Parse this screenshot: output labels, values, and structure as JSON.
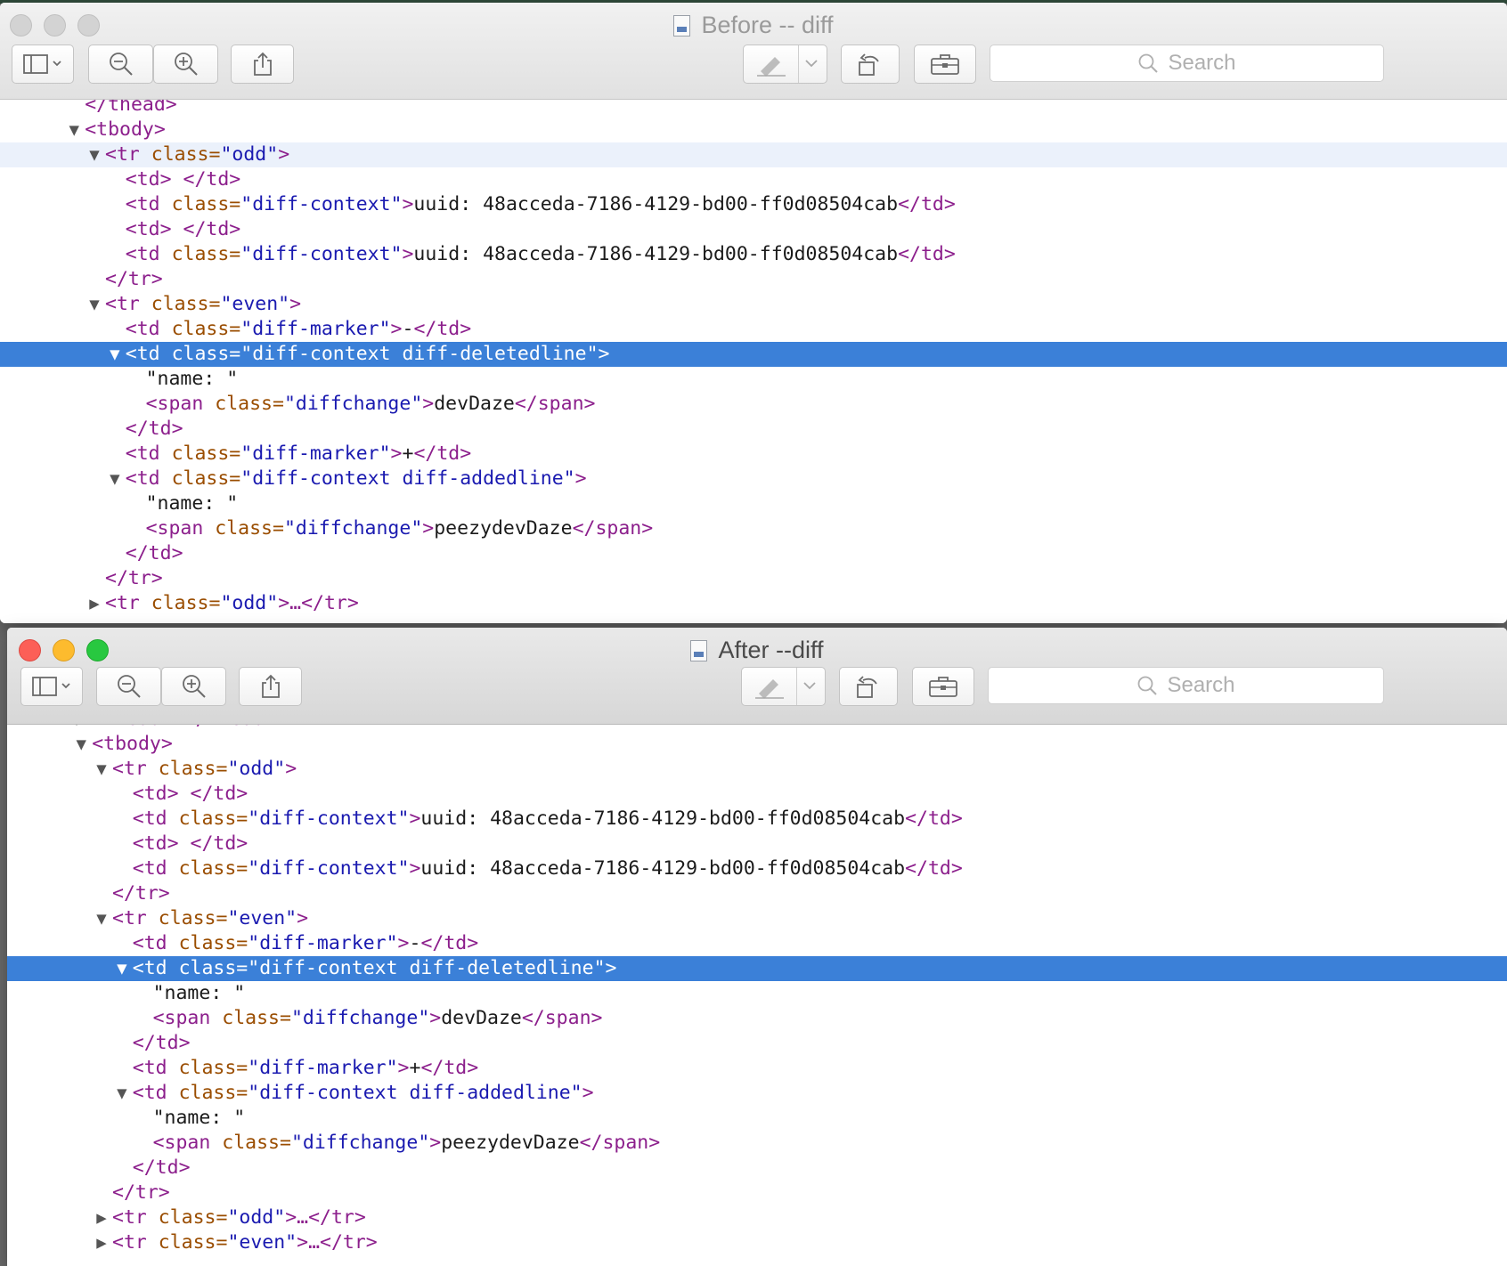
{
  "windows": [
    {
      "title": "Before -- diff",
      "search_placeholder": "Search",
      "icons": [
        "sidebar-icon",
        "zoom-out-icon",
        "zoom-in-icon",
        "share-icon",
        "markup-icon",
        "rotate-icon",
        "toolbox-icon",
        "search-icon"
      ],
      "lines": [
        {
          "indent": 4,
          "disc": "",
          "parts": [
            [
              "t",
              "</thead>"
            ]
          ]
        },
        {
          "indent": 4,
          "disc": "open",
          "parts": [
            [
              "t",
              "<tbody>"
            ]
          ]
        },
        {
          "indent": 5,
          "disc": "open",
          "hover": true,
          "parts": [
            [
              "t",
              "<tr "
            ],
            [
              "a",
              "class="
            ],
            [
              "v",
              "\"odd\""
            ],
            [
              "t",
              ">"
            ]
          ]
        },
        {
          "indent": 6,
          "disc": "",
          "parts": [
            [
              "t",
              "<td> </td>"
            ]
          ]
        },
        {
          "indent": 6,
          "disc": "",
          "parts": [
            [
              "t",
              "<td "
            ],
            [
              "a",
              "class="
            ],
            [
              "v",
              "\"diff-context\""
            ],
            [
              "t",
              ">"
            ],
            [
              "x",
              "uuid: 48acceda-7186-4129-bd00-ff0d08504cab"
            ],
            [
              "t",
              "</td>"
            ]
          ]
        },
        {
          "indent": 6,
          "disc": "",
          "parts": [
            [
              "t",
              "<td> </td>"
            ]
          ]
        },
        {
          "indent": 6,
          "disc": "",
          "parts": [
            [
              "t",
              "<td "
            ],
            [
              "a",
              "class="
            ],
            [
              "v",
              "\"diff-context\""
            ],
            [
              "t",
              ">"
            ],
            [
              "x",
              "uuid: 48acceda-7186-4129-bd00-ff0d08504cab"
            ],
            [
              "t",
              "</td>"
            ]
          ]
        },
        {
          "indent": 5,
          "disc": "",
          "parts": [
            [
              "t",
              "</tr>"
            ]
          ]
        },
        {
          "indent": 5,
          "disc": "open",
          "parts": [
            [
              "t",
              "<tr "
            ],
            [
              "a",
              "class="
            ],
            [
              "v",
              "\"even\""
            ],
            [
              "t",
              ">"
            ]
          ]
        },
        {
          "indent": 6,
          "disc": "",
          "parts": [
            [
              "t",
              "<td "
            ],
            [
              "a",
              "class="
            ],
            [
              "v",
              "\"diff-marker\""
            ],
            [
              "t",
              ">"
            ],
            [
              "x",
              "-"
            ],
            [
              "t",
              "</td>"
            ]
          ]
        },
        {
          "indent": 6,
          "disc": "open",
          "selected": true,
          "parts": [
            [
              "t",
              "<td "
            ],
            [
              "a",
              "class="
            ],
            [
              "v",
              "\"diff-context diff-deletedline\""
            ],
            [
              "t",
              ">"
            ]
          ]
        },
        {
          "indent": 7,
          "disc": "",
          "parts": [
            [
              "x",
              "\"name: \""
            ]
          ]
        },
        {
          "indent": 7,
          "disc": "",
          "parts": [
            [
              "t",
              "<span "
            ],
            [
              "a",
              "class="
            ],
            [
              "v",
              "\"diffchange\""
            ],
            [
              "t",
              ">"
            ],
            [
              "x",
              "devDaze"
            ],
            [
              "t",
              "</span>"
            ]
          ]
        },
        {
          "indent": 6,
          "disc": "",
          "parts": [
            [
              "t",
              "</td>"
            ]
          ]
        },
        {
          "indent": 6,
          "disc": "",
          "parts": [
            [
              "t",
              "<td "
            ],
            [
              "a",
              "class="
            ],
            [
              "v",
              "\"diff-marker\""
            ],
            [
              "t",
              ">"
            ],
            [
              "x",
              "+"
            ],
            [
              "t",
              "</td>"
            ]
          ]
        },
        {
          "indent": 6,
          "disc": "open",
          "parts": [
            [
              "t",
              "<td "
            ],
            [
              "a",
              "class="
            ],
            [
              "v",
              "\"diff-context diff-addedline\""
            ],
            [
              "t",
              ">"
            ]
          ]
        },
        {
          "indent": 7,
          "disc": "",
          "parts": [
            [
              "x",
              "\"name: \""
            ]
          ]
        },
        {
          "indent": 7,
          "disc": "",
          "parts": [
            [
              "t",
              "<span "
            ],
            [
              "a",
              "class="
            ],
            [
              "v",
              "\"diffchange\""
            ],
            [
              "t",
              ">"
            ],
            [
              "x",
              "peezydevDaze"
            ],
            [
              "t",
              "</span>"
            ]
          ]
        },
        {
          "indent": 6,
          "disc": "",
          "parts": [
            [
              "t",
              "</td>"
            ]
          ]
        },
        {
          "indent": 5,
          "disc": "",
          "parts": [
            [
              "t",
              "</tr>"
            ]
          ]
        },
        {
          "indent": 5,
          "disc": "closed",
          "parts": [
            [
              "t",
              "<tr "
            ],
            [
              "a",
              "class="
            ],
            [
              "v",
              "\"odd\""
            ],
            [
              "t",
              ">…</tr>"
            ]
          ]
        }
      ]
    },
    {
      "title": "After --diff",
      "search_placeholder": "Search",
      "icons": [
        "sidebar-icon",
        "zoom-out-icon",
        "zoom-in-icon",
        "share-icon",
        "markup-icon",
        "rotate-icon",
        "toolbox-icon",
        "search-icon"
      ],
      "lines": [
        {
          "indent": 4,
          "disc": "closed",
          "parts": [
            [
              "t",
              "<thead>…</thead>"
            ]
          ]
        },
        {
          "indent": 4,
          "disc": "open",
          "parts": [
            [
              "t",
              "<tbody>"
            ]
          ]
        },
        {
          "indent": 5,
          "disc": "open",
          "parts": [
            [
              "t",
              "<tr "
            ],
            [
              "a",
              "class="
            ],
            [
              "v",
              "\"odd\""
            ],
            [
              "t",
              ">"
            ]
          ]
        },
        {
          "indent": 6,
          "disc": "",
          "parts": [
            [
              "t",
              "<td> </td>"
            ]
          ]
        },
        {
          "indent": 6,
          "disc": "",
          "parts": [
            [
              "t",
              "<td "
            ],
            [
              "a",
              "class="
            ],
            [
              "v",
              "\"diff-context\""
            ],
            [
              "t",
              ">"
            ],
            [
              "x",
              "uuid: 48acceda-7186-4129-bd00-ff0d08504cab"
            ],
            [
              "t",
              "</td>"
            ]
          ]
        },
        {
          "indent": 6,
          "disc": "",
          "parts": [
            [
              "t",
              "<td> </td>"
            ]
          ]
        },
        {
          "indent": 6,
          "disc": "",
          "parts": [
            [
              "t",
              "<td "
            ],
            [
              "a",
              "class="
            ],
            [
              "v",
              "\"diff-context\""
            ],
            [
              "t",
              ">"
            ],
            [
              "x",
              "uuid: 48acceda-7186-4129-bd00-ff0d08504cab"
            ],
            [
              "t",
              "</td>"
            ]
          ]
        },
        {
          "indent": 5,
          "disc": "",
          "parts": [
            [
              "t",
              "</tr>"
            ]
          ]
        },
        {
          "indent": 5,
          "disc": "open",
          "parts": [
            [
              "t",
              "<tr "
            ],
            [
              "a",
              "class="
            ],
            [
              "v",
              "\"even\""
            ],
            [
              "t",
              ">"
            ]
          ]
        },
        {
          "indent": 6,
          "disc": "",
          "parts": [
            [
              "t",
              "<td "
            ],
            [
              "a",
              "class="
            ],
            [
              "v",
              "\"diff-marker\""
            ],
            [
              "t",
              ">"
            ],
            [
              "x",
              "-"
            ],
            [
              "t",
              "</td>"
            ]
          ]
        },
        {
          "indent": 6,
          "disc": "open",
          "selected": true,
          "parts": [
            [
              "t",
              "<td "
            ],
            [
              "a",
              "class="
            ],
            [
              "v",
              "\"diff-context diff-deletedline\""
            ],
            [
              "t",
              ">"
            ]
          ]
        },
        {
          "indent": 7,
          "disc": "",
          "parts": [
            [
              "x",
              "\"name: \""
            ]
          ]
        },
        {
          "indent": 7,
          "disc": "",
          "parts": [
            [
              "t",
              "<span "
            ],
            [
              "a",
              "class="
            ],
            [
              "v",
              "\"diffchange\""
            ],
            [
              "t",
              ">"
            ],
            [
              "x",
              "devDaze"
            ],
            [
              "t",
              "</span>"
            ]
          ]
        },
        {
          "indent": 6,
          "disc": "",
          "parts": [
            [
              "t",
              "</td>"
            ]
          ]
        },
        {
          "indent": 6,
          "disc": "",
          "parts": [
            [
              "t",
              "<td "
            ],
            [
              "a",
              "class="
            ],
            [
              "v",
              "\"diff-marker\""
            ],
            [
              "t",
              ">"
            ],
            [
              "x",
              "+"
            ],
            [
              "t",
              "</td>"
            ]
          ]
        },
        {
          "indent": 6,
          "disc": "open",
          "parts": [
            [
              "t",
              "<td "
            ],
            [
              "a",
              "class="
            ],
            [
              "v",
              "\"diff-context diff-addedline\""
            ],
            [
              "t",
              ">"
            ]
          ]
        },
        {
          "indent": 7,
          "disc": "",
          "parts": [
            [
              "x",
              "\"name: \""
            ]
          ]
        },
        {
          "indent": 7,
          "disc": "",
          "parts": [
            [
              "t",
              "<span "
            ],
            [
              "a",
              "class="
            ],
            [
              "v",
              "\"diffchange\""
            ],
            [
              "t",
              ">"
            ],
            [
              "x",
              "peezydevDaze"
            ],
            [
              "t",
              "</span>"
            ]
          ]
        },
        {
          "indent": 6,
          "disc": "",
          "parts": [
            [
              "t",
              "</td>"
            ]
          ]
        },
        {
          "indent": 5,
          "disc": "",
          "parts": [
            [
              "t",
              "</tr>"
            ]
          ]
        },
        {
          "indent": 5,
          "disc": "closed",
          "parts": [
            [
              "t",
              "<tr "
            ],
            [
              "a",
              "class="
            ],
            [
              "v",
              "\"odd\""
            ],
            [
              "t",
              ">…</tr>"
            ]
          ]
        },
        {
          "indent": 5,
          "disc": "closed",
          "parts": [
            [
              "t",
              "<tr "
            ],
            [
              "a",
              "class="
            ],
            [
              "v",
              "\"even\""
            ],
            [
              "t",
              ">…</tr>"
            ]
          ]
        }
      ]
    }
  ]
}
